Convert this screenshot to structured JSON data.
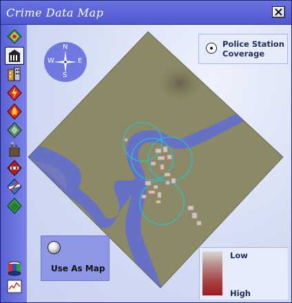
{
  "window": {
    "title": "Crime Data Map",
    "close_label": "×"
  },
  "toolbar": {
    "tools": [
      {
        "name": "layers-tool",
        "icon": "layers-icon",
        "active": false
      },
      {
        "name": "police-station-tool",
        "icon": "police-station-icon",
        "active": true
      },
      {
        "name": "buildings-tool",
        "icon": "buildings-icon",
        "active": false
      },
      {
        "name": "power-tool",
        "icon": "lightning-icon",
        "active": false
      },
      {
        "name": "fire-tool",
        "icon": "fire-icon",
        "active": false
      },
      {
        "name": "terrain-tool",
        "icon": "diamond-icon",
        "active": false
      },
      {
        "name": "pollution-tool",
        "icon": "pollution-icon",
        "active": false
      },
      {
        "name": "crime-tool",
        "icon": "crime-icon",
        "active": false
      },
      {
        "name": "transport-tool",
        "icon": "transport-icon",
        "active": false
      },
      {
        "name": "land-value-tool",
        "icon": "land-value-icon",
        "active": false
      }
    ],
    "bottom_tools": [
      {
        "name": "population-tool",
        "icon": "cylinder-chart-icon"
      },
      {
        "name": "graph-tool",
        "icon": "graph-icon"
      }
    ]
  },
  "compass": {
    "n": "N",
    "s": "S",
    "e": "E",
    "w": "W"
  },
  "legend": {
    "label": "Police Station Coverage",
    "icon": "police-station-marker-icon"
  },
  "use_as_map": {
    "label": "Use As Map",
    "selected": false
  },
  "scale": {
    "low": "Low",
    "high": "High",
    "low_color": "#d9d6d6",
    "high_color": "#a01818"
  },
  "colors": {
    "land": "#8c8a66",
    "water": "#6670c4",
    "coverage_ring": "#29c0d0",
    "crime": "#d06a6a"
  }
}
